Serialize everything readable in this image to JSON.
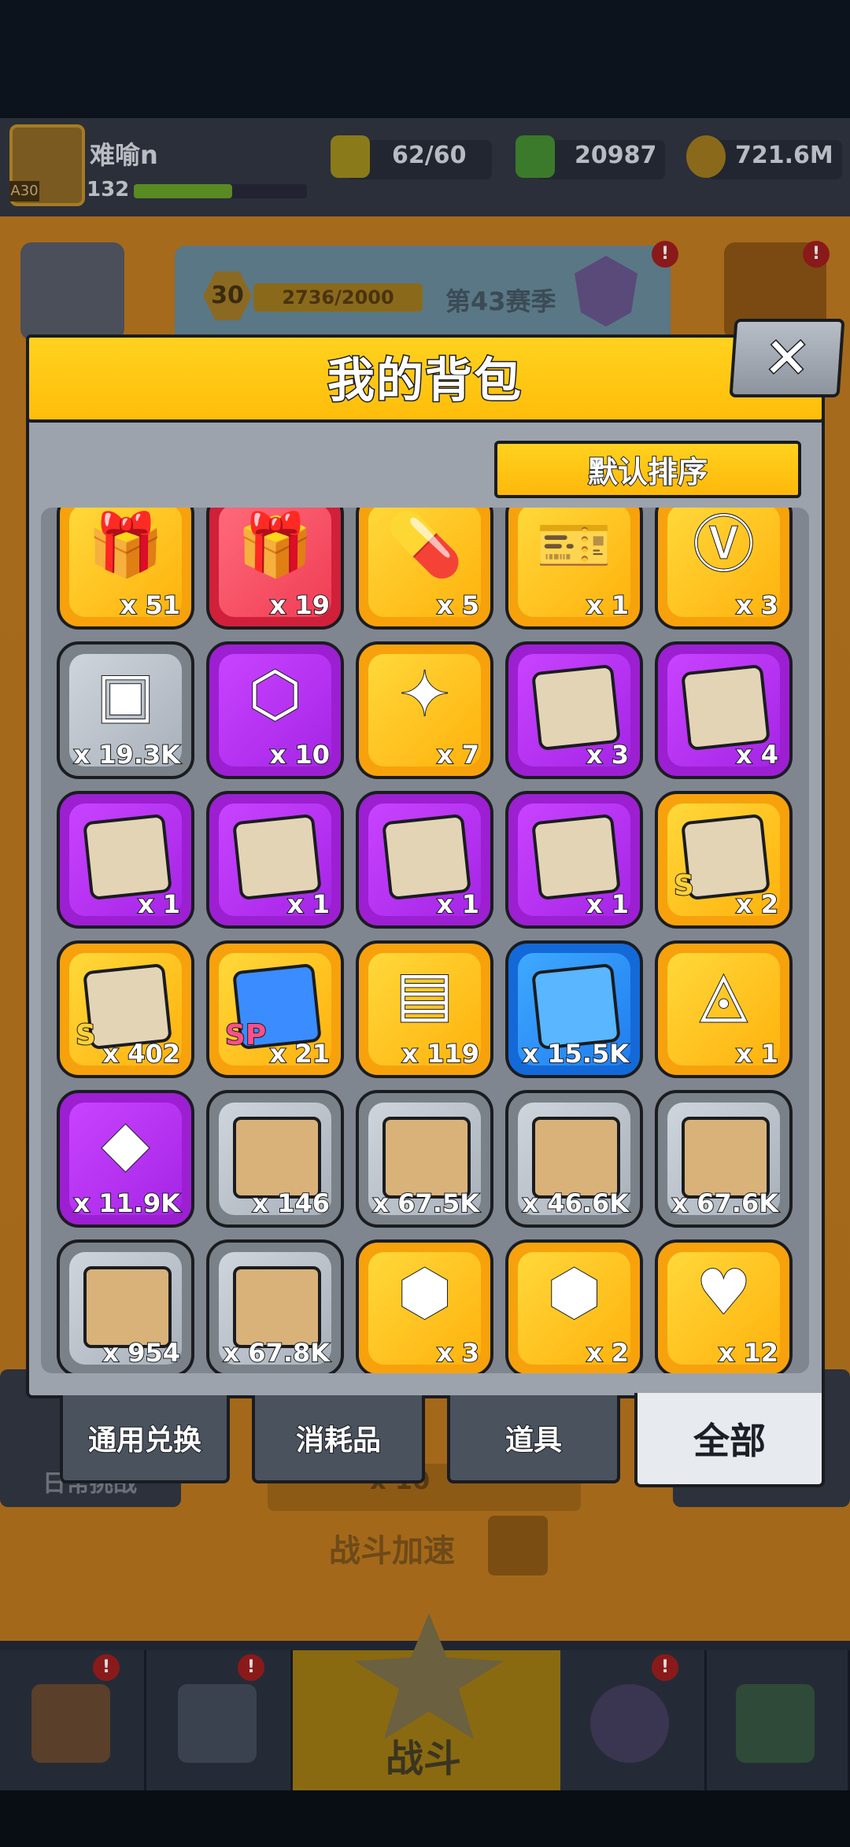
{
  "hud": {
    "player_level": "A30",
    "player_name": "难喻n",
    "player_sub": "132",
    "energy": "62/60",
    "gems": "20987",
    "gold": "721.6M"
  },
  "season": {
    "level": "30",
    "progress": "2736/2000",
    "label": "第43赛季",
    "alert": "!"
  },
  "background": {
    "left_chip": "日常挑战",
    "reward_text": "x 10",
    "speed_label": "战斗加速",
    "battle_label": "战斗"
  },
  "modal": {
    "title": "我的背包",
    "close": "✕",
    "sort_label": "默认排序"
  },
  "items": [
    {
      "icon": "gift-box-icon",
      "tier": "gold",
      "count": "x 51"
    },
    {
      "icon": "gift-box-plus-icon",
      "tier": "red",
      "count": "x 19"
    },
    {
      "icon": "capsule-pill-icon",
      "tier": "gold",
      "count": "x 5"
    },
    {
      "icon": "v-ticket-icon",
      "tier": "gold",
      "count": "x 1"
    },
    {
      "icon": "v-coin-icon",
      "tier": "gold",
      "count": "x 3"
    },
    {
      "icon": "metal-cube-icon",
      "tier": "gray",
      "count": "x 19.3K"
    },
    {
      "icon": "energy-canister-icon",
      "tier": "purple",
      "count": "x 10"
    },
    {
      "icon": "gold-star-icon",
      "tier": "gold",
      "count": "x 7"
    },
    {
      "icon": "hero-puzzle-icon",
      "tier": "purple",
      "count": "x 3"
    },
    {
      "icon": "hero-puzzle-icon",
      "tier": "purple",
      "count": "x 4"
    },
    {
      "icon": "hero-puzzle-icon",
      "tier": "purple",
      "count": "x 1"
    },
    {
      "icon": "hero-puzzle-icon",
      "tier": "purple",
      "count": "x 1"
    },
    {
      "icon": "hero-puzzle-icon",
      "tier": "purple",
      "count": "x 1"
    },
    {
      "icon": "hero-puzzle-icon",
      "tier": "purple",
      "count": "x 1"
    },
    {
      "icon": "s-hero-puzzle-icon",
      "tier": "gold",
      "count": "x 2",
      "mark": "S"
    },
    {
      "icon": "s-hero-puzzle-icon",
      "tier": "gold",
      "count": "x 402",
      "mark": "S"
    },
    {
      "icon": "sp-puzzle-icon",
      "tier": "gold",
      "count": "x 21",
      "mark": "SP"
    },
    {
      "icon": "treasure-chest-icon",
      "tier": "gold",
      "count": "x 119"
    },
    {
      "icon": "blue-puzzle-icon",
      "tier": "blue",
      "count": "x 15.5K"
    },
    {
      "icon": "red-crystal-icon",
      "tier": "gold",
      "count": "x 1"
    },
    {
      "icon": "purple-gem-icon",
      "tier": "purple",
      "count": "x 11.9K"
    },
    {
      "icon": "pistol-blueprint-icon",
      "tier": "gray",
      "count": "x 146"
    },
    {
      "icon": "armor-blueprint-icon",
      "tier": "gray",
      "count": "x 67.5K"
    },
    {
      "icon": "necklace-blueprint-icon",
      "tier": "gray",
      "count": "x 46.6K"
    },
    {
      "icon": "belt-blueprint-icon",
      "tier": "gray",
      "count": "x 67.6K"
    },
    {
      "icon": "glove-blueprint-icon",
      "tier": "gray",
      "count": "x 954"
    },
    {
      "icon": "boots-blueprint-icon",
      "tier": "gray",
      "count": "x 67.8K"
    },
    {
      "icon": "gold-chest-icon",
      "tier": "gold",
      "count": "x 3"
    },
    {
      "icon": "gold-chest-arrow-icon",
      "tier": "gold",
      "count": "x 2"
    },
    {
      "icon": "heart-medal-chest-icon",
      "tier": "gold",
      "count": "x 12"
    }
  ],
  "tabs": [
    {
      "label": "通用兑换",
      "active": false
    },
    {
      "label": "消耗品",
      "active": false
    },
    {
      "label": "道具",
      "active": false
    },
    {
      "label": "全部",
      "active": true
    }
  ]
}
